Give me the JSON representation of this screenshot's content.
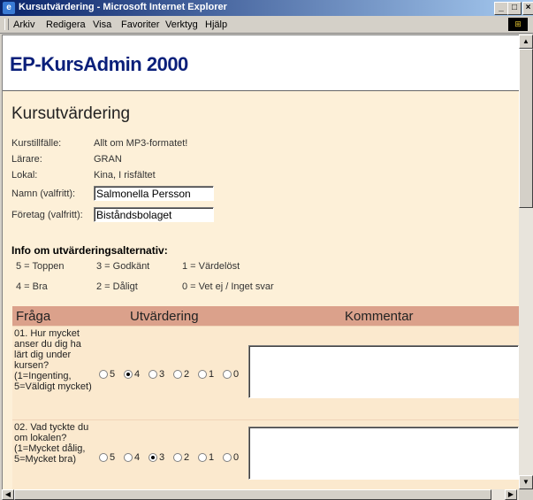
{
  "window": {
    "title": "Kursutvärdering - Microsoft Internet Explorer"
  },
  "menu": [
    "Arkiv",
    "Redigera",
    "Visa",
    "Favoriter",
    "Verktyg",
    "Hjälp"
  ],
  "header": {
    "brand": "EP-KursAdmin 2000"
  },
  "page": {
    "title": "Kursutvärdering"
  },
  "course": {
    "instance_label": "Kurstillfälle:",
    "instance_value": "Allt om MP3-formatet!",
    "teacher_label": "Lärare:",
    "teacher_value": "GRAN",
    "room_label": "Lokal:",
    "room_value": "Kina, I risfältet",
    "name_label": "Namn (valfritt):",
    "name_value": "Salmonella Persson",
    "company_label": "Företag (valfritt):",
    "company_value": "Biståndsbolaget"
  },
  "info": {
    "heading": "Info om utvärderingsalternativ:",
    "legend": [
      "5 = Toppen",
      "3 = Godkänt",
      "1 = Värdelöst",
      "4 = Bra",
      "2 = Dåligt",
      "0 = Vet ej / Inget svar"
    ]
  },
  "grid": {
    "headers": [
      "Fråga",
      "Utvärdering",
      "Kommentar"
    ],
    "questions": [
      {
        "text": "01. Hur mycket anser du dig ha lärt dig under kursen? (1=Ingenting, 5=Väldigt mycket)",
        "selected": "4"
      },
      {
        "text": "02. Vad tyckte du om lokalen? (1=Mycket dålig, 5=Mycket bra)",
        "selected": "3"
      }
    ],
    "options": [
      "5",
      "4",
      "3",
      "2",
      "1",
      "0"
    ]
  }
}
